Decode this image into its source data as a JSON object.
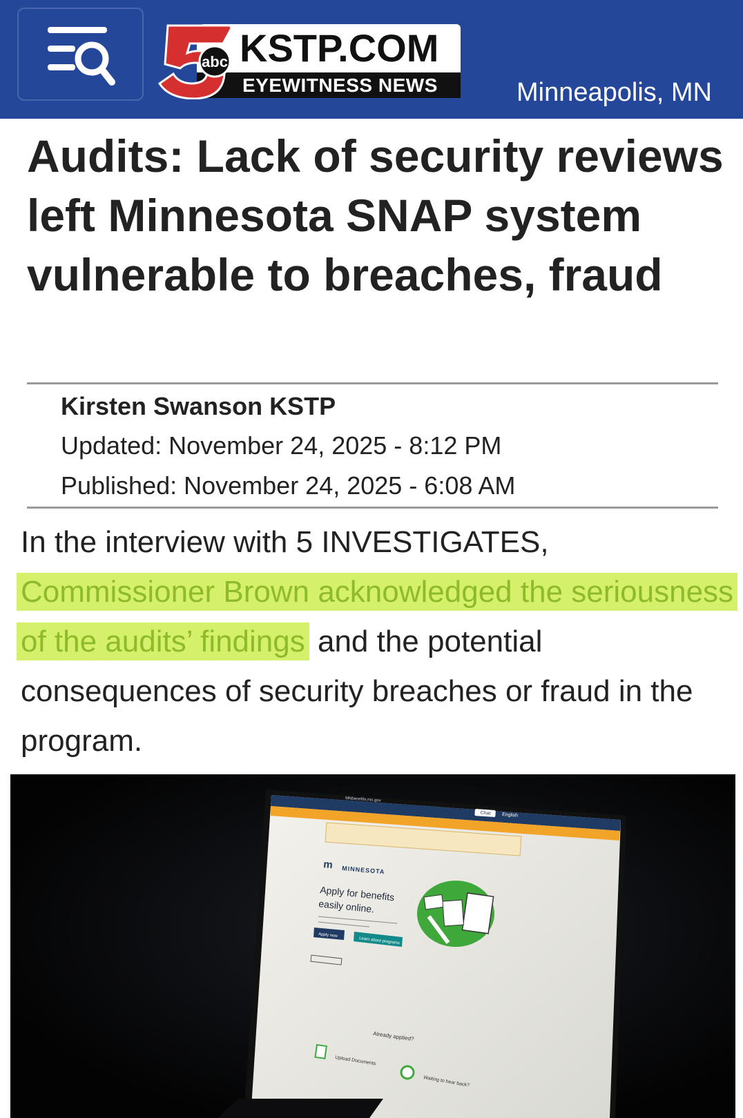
{
  "header": {
    "menu_icon": "menu-search-icon",
    "logo": {
      "number": "5",
      "network": "abc",
      "site": "KSTP.COM",
      "tagline": "EYEWITNESS NEWS"
    },
    "location": "Minneapolis, MN"
  },
  "article": {
    "headline": "Audits: Lack of security reviews left Minnesota SNAP system vulnerable to breaches, fraud",
    "author": "Kirsten Swanson KSTP",
    "updated": "Updated: November 24, 2025 - 8:12 PM",
    "published": "Published: November 24, 2025 - 6:08 AM",
    "paragraph": {
      "lead": "In the interview with 5 INVESTIGATES, ",
      "highlight": "Commissioner Brown acknowledged the seriousness of the audits’ findings",
      "tail": " and the potential consequences of security breaches or fraud in the program."
    }
  },
  "photo": {
    "screen_site_name": "MNbenefits.mn.gov",
    "chat_label": "Chat",
    "language": "English",
    "brand": "MINNESOTA",
    "heading_line1": "Apply for benefits",
    "heading_line2": "easily online.",
    "apply_button": "Apply now",
    "progress_button": "Learn about programs",
    "already_applied": "Already applied?",
    "upload_documents": "Upload Documents",
    "waiting": "Waiting to hear back?"
  },
  "colors": {
    "header_bg": "#24479a",
    "highlight_bg": "#d5f16b",
    "highlight_text": "#8fbb2a",
    "logo_red": "#d62f2f"
  }
}
